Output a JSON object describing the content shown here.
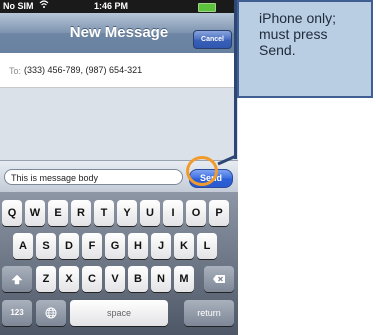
{
  "statusbar": {
    "carrier": "No SIM",
    "time": "1:46 PM",
    "wifi_icon": "wifi-icon",
    "battery_icon": "battery-icon"
  },
  "navbar": {
    "title": "New Message",
    "cancel_label": "Cancel"
  },
  "to_row": {
    "label": "To:",
    "recipients": "(333) 456-789, (987) 654-321"
  },
  "composer": {
    "message": "This is message body",
    "send_label": "Send"
  },
  "keyboard": {
    "row1": [
      "Q",
      "W",
      "E",
      "R",
      "T",
      "Y",
      "U",
      "I",
      "O",
      "P"
    ],
    "row2": [
      "A",
      "S",
      "D",
      "F",
      "G",
      "H",
      "J",
      "K",
      "L"
    ],
    "row3": [
      "Z",
      "X",
      "C",
      "V",
      "B",
      "N",
      "M"
    ],
    "shift_icon": "shift-icon",
    "delete_icon": "delete-icon",
    "num_label": "123",
    "globe_icon": "globe-icon",
    "space_label": "space",
    "return_label": "return"
  },
  "callout": {
    "text": "iPhone only; must press Send."
  },
  "colors": {
    "callout_bg": "#b9cde3",
    "callout_border": "#3f5f92",
    "highlight": "#f29b2d",
    "send_blue": "#2c5fd6"
  }
}
